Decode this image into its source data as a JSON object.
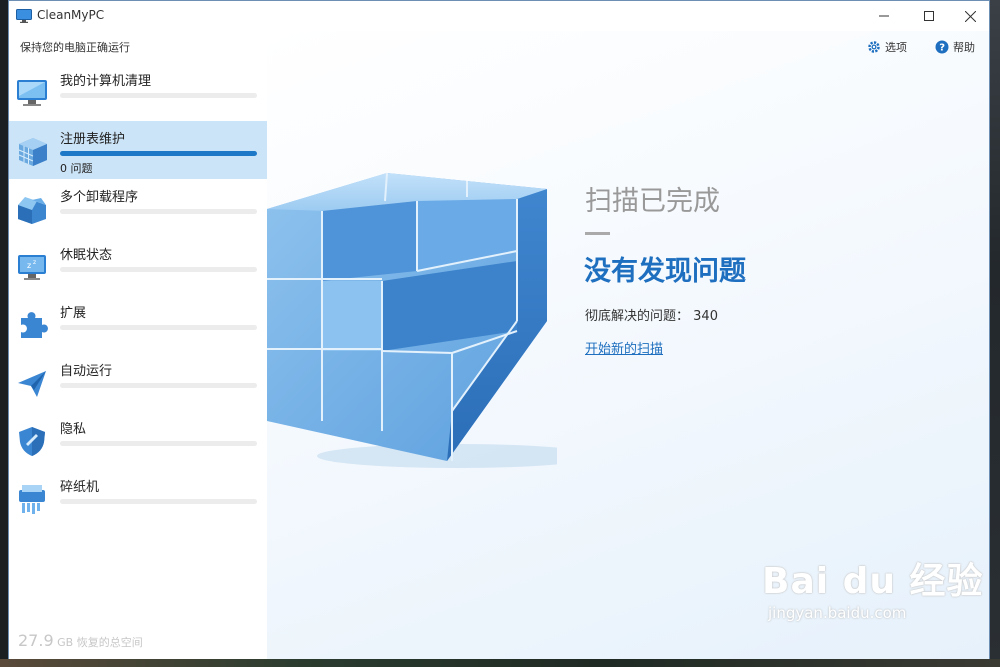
{
  "window": {
    "title": "CleanMyPC",
    "controls": [
      "minimize",
      "maximize",
      "close"
    ]
  },
  "sidebar": {
    "subtitle": "保持您的电脑正确运行",
    "items": [
      {
        "label": "我的计算机清理",
        "icon": "monitor-icon",
        "active": false,
        "progress": 0
      },
      {
        "label": "注册表维护",
        "icon": "registry-cube-icon",
        "active": true,
        "progress": 1.0,
        "sub": "0 问题"
      },
      {
        "label": "多个卸载程序",
        "icon": "box-icon",
        "active": false,
        "progress": 0
      },
      {
        "label": "休眠状态",
        "icon": "sleep-monitor-icon",
        "active": false,
        "progress": 0
      },
      {
        "label": "扩展",
        "icon": "puzzle-icon",
        "active": false,
        "progress": 0
      },
      {
        "label": "自动运行",
        "icon": "paper-plane-icon",
        "active": false,
        "progress": 0
      },
      {
        "label": "隐私",
        "icon": "shield-icon",
        "active": false,
        "progress": 0
      },
      {
        "label": "碎纸机",
        "icon": "shredder-icon",
        "active": false,
        "progress": 0
      }
    ],
    "footer": {
      "value": "27.9",
      "unit": "GB",
      "label": "恢复的总空间"
    }
  },
  "topbar": {
    "options_label": "选项",
    "help_label": "帮助"
  },
  "main": {
    "status_title": "扫描已完成",
    "headline": "没有发现问题",
    "resolved_label": "彻底解决的问题：",
    "resolved_count": "340",
    "new_scan_link": "开始新的扫描"
  },
  "watermark": {
    "brand": "Bai du 经验",
    "url": "jingyan.baidu.com"
  },
  "colors": {
    "accent": "#1e78c8",
    "active_item_bg": "#cce4f7",
    "headline": "#1e6fbf",
    "cube_light": "#8ec1ec",
    "cube_dark": "#3a82cc"
  }
}
